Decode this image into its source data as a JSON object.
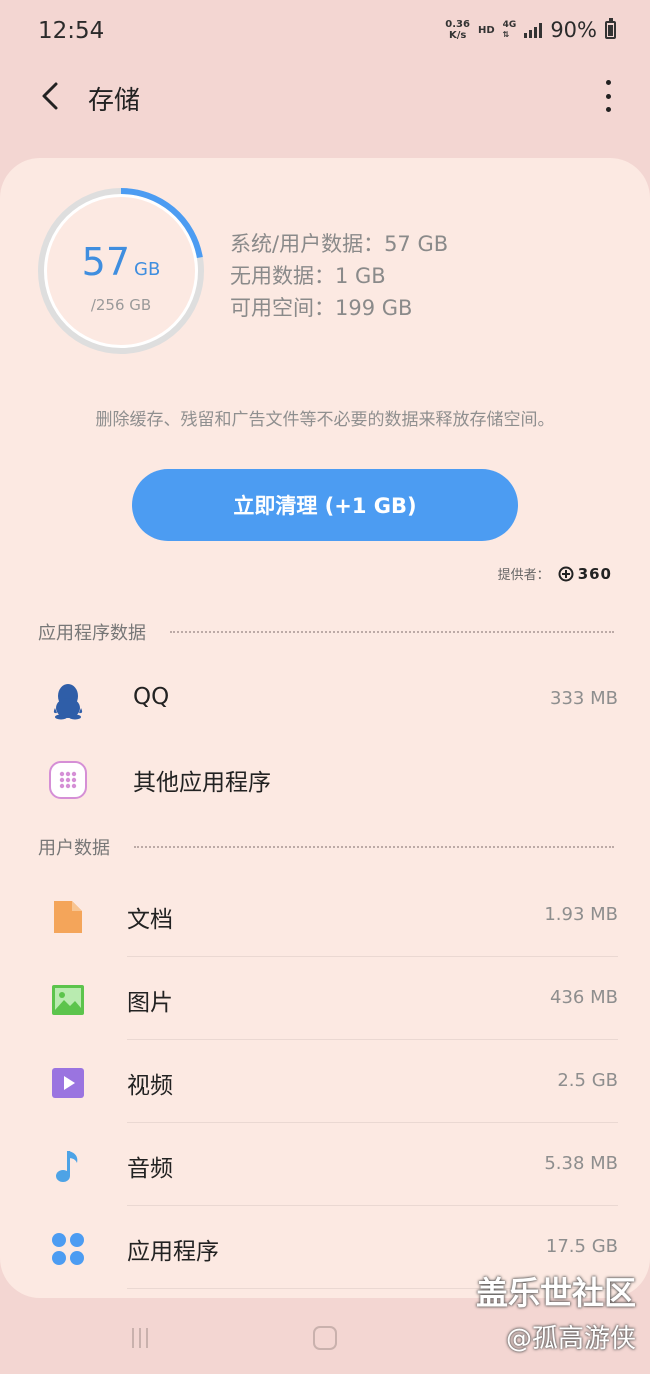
{
  "status_bar": {
    "time": "12:54",
    "net_speed_value": "0.36",
    "net_speed_unit": "K/s",
    "hd_label": "HD",
    "network_label": "4G",
    "battery_percent": "90%"
  },
  "header": {
    "title": "存储"
  },
  "storage": {
    "used_value": "57",
    "used_unit": "GB",
    "total": "/256 GB",
    "used_fraction": 0.223,
    "stats": [
      "系统/用户数据：57 GB",
      "无用数据：1 GB",
      "可用空间：199 GB"
    ],
    "description": "删除缓存、残留和广告文件等不必要的数据来释放存储空间。",
    "clean_button": "立即清理 (+1 GB)",
    "provider_label": "提供者：",
    "provider_name": "360"
  },
  "app_section": {
    "title": "应用程序数据",
    "items": [
      {
        "name": "QQ",
        "size": "333 MB",
        "icon": "qq-penguin-icon"
      },
      {
        "name": "其他应用程序",
        "size": "",
        "icon": "apps-grid-icon"
      }
    ]
  },
  "user_section": {
    "title": "用户数据",
    "items": [
      {
        "name": "文档",
        "size": "1.93 MB",
        "icon": "document-icon"
      },
      {
        "name": "图片",
        "size": "436 MB",
        "icon": "image-icon"
      },
      {
        "name": "视频",
        "size": "2.5 GB",
        "icon": "video-icon"
      },
      {
        "name": "音频",
        "size": "5.38 MB",
        "icon": "audio-icon"
      },
      {
        "name": "应用程序",
        "size": "17.5 GB",
        "icon": "applications-icon"
      }
    ]
  },
  "watermark": {
    "line1": "盖乐世社区",
    "line2": "@孤高游侠"
  },
  "colors": {
    "accent": "#4c9cf2",
    "background": "#f3d6d2",
    "card": "#fce9e2"
  }
}
